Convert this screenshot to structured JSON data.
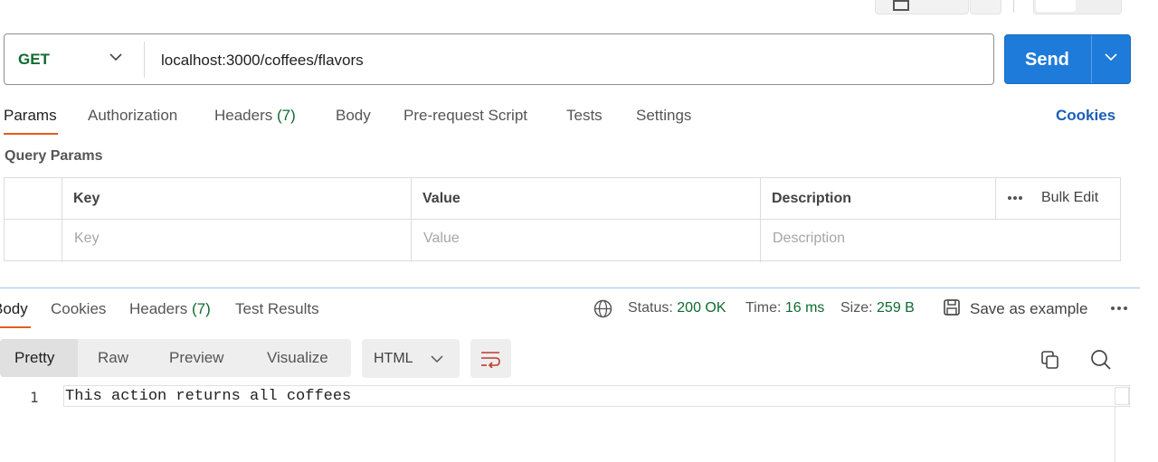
{
  "request": {
    "method": "GET",
    "url": "localhost:3000/coffees/flavors",
    "send_label": "Send"
  },
  "request_tabs": [
    {
      "label": "Params",
      "active": true
    },
    {
      "label": "Authorization"
    },
    {
      "label": "Headers",
      "count": "(7)"
    },
    {
      "label": "Body"
    },
    {
      "label": "Pre-request Script"
    },
    {
      "label": "Tests"
    },
    {
      "label": "Settings"
    }
  ],
  "cookies_link": "Cookies",
  "query_params": {
    "title": "Query Params",
    "columns": [
      "Key",
      "Value",
      "Description"
    ],
    "placeholders": [
      "Key",
      "Value",
      "Description"
    ],
    "bulk_edit": "Bulk Edit"
  },
  "response_tabs": [
    {
      "label": "Body",
      "active": true
    },
    {
      "label": "Cookies"
    },
    {
      "label": "Headers",
      "count": "(7)"
    },
    {
      "label": "Test Results"
    }
  ],
  "response_meta": {
    "status_label": "Status:",
    "status_value": "200 OK",
    "time_label": "Time:",
    "time_value": "16 ms",
    "size_label": "Size:",
    "size_value": "259 B",
    "save_example": "Save as example"
  },
  "view_modes": [
    "Pretty",
    "Raw",
    "Preview",
    "Visualize"
  ],
  "format": "HTML",
  "code": {
    "line_number": "1",
    "text": "This action returns all coffees"
  },
  "colors": {
    "accent": "#1e7bd9",
    "success": "#0f6b2f",
    "active_tab": "#e35e1e",
    "link": "#1a5fb4"
  }
}
